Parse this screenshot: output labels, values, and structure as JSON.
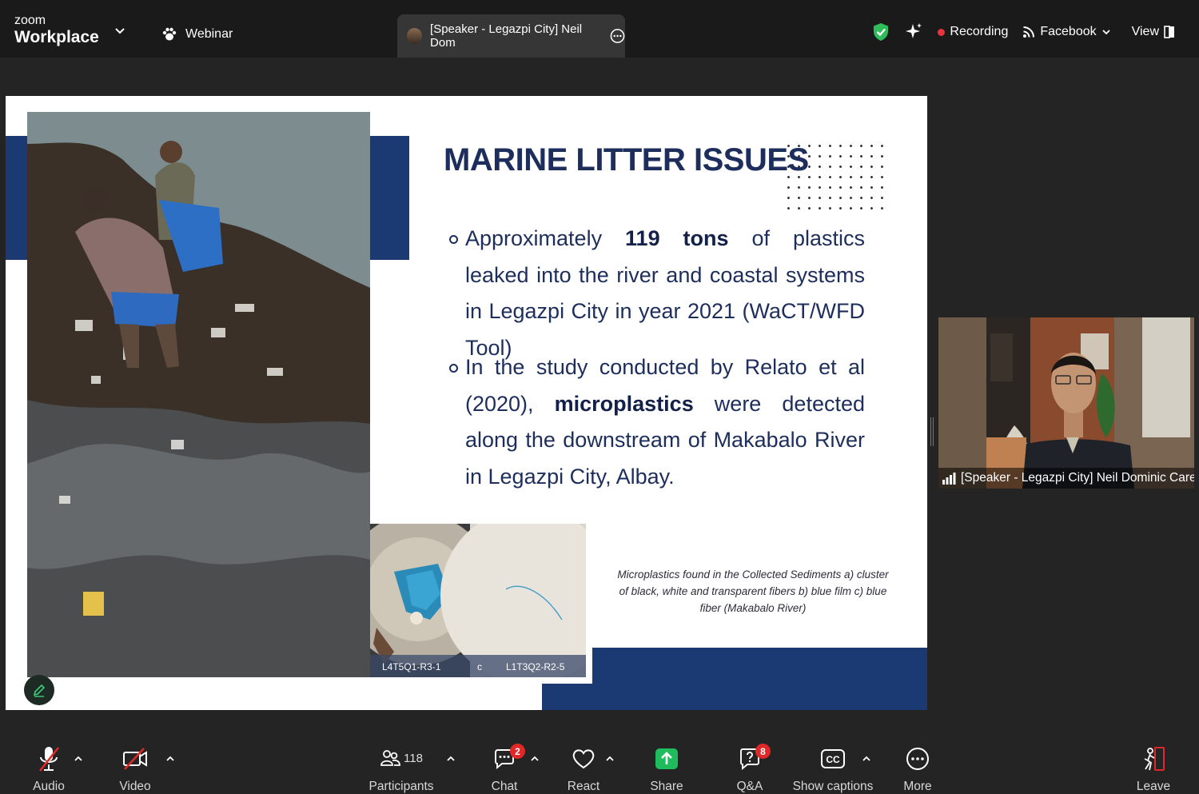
{
  "topbar": {
    "brand_small": "zoom",
    "brand_large": "Workplace",
    "mode_label": "Webinar",
    "active_tab": "[Speaker - Legazpi City] Neil Dom",
    "recording_label": "Recording",
    "stream_label": "Facebook",
    "view_label": "View"
  },
  "slide": {
    "title": "MARINE LITTER ISSUES",
    "bullet1": {
      "pre": "Approximately ",
      "bold": "119 tons",
      "post": " of plastics leaked into the river and coastal systems in Legazpi City in year 2021 (WaCT/WFD Tool)"
    },
    "bullet2": {
      "pre": "In the study conducted by Relato et al (2020), ",
      "bold": "microplastics",
      "post": " were detected along the downstream of Makabalo River in Legazpi City, Albay."
    },
    "micro_label_a": "L4T5Q1-R3-1",
    "micro_label_c": "c",
    "micro_label_b": "L1T3Q2-R2-5",
    "caption": "Microplastics found in the Collected Sediments a) cluster of black, white and transparent fibers b) blue film c) blue fiber (Makabalo River)"
  },
  "video": {
    "name": "[Speaker - Legazpi City] Neil Dominic Careo"
  },
  "toolbar": {
    "audio": "Audio",
    "video": "Video",
    "participants": "Participants",
    "participants_count": "118",
    "chat": "Chat",
    "chat_badge": "2",
    "react": "React",
    "share": "Share",
    "qa": "Q&A",
    "qa_badge": "8",
    "captions": "Show captions",
    "more": "More",
    "leave": "Leave"
  },
  "colors": {
    "slide_navy": "#1b3a73",
    "recording_red": "#e8343c",
    "share_green": "#1fbc5d",
    "badge_red": "#e02828",
    "security_green": "#2ebd59"
  }
}
